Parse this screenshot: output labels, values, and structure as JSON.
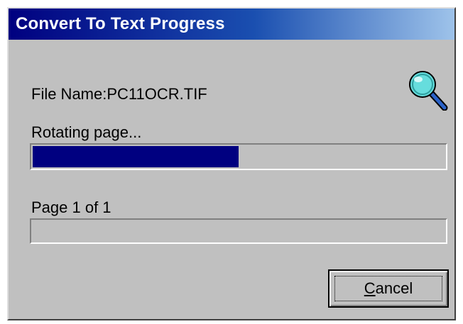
{
  "window": {
    "title": "Convert To Text Progress"
  },
  "file": {
    "label": "File Name:PC11OCR.TIF"
  },
  "status": {
    "text": "Rotating page..."
  },
  "progress": {
    "main_fraction": 0.5,
    "page_label": "Page 1 of 1",
    "pages_fraction": 0.0
  },
  "buttons": {
    "cancel_mnemonic": "C",
    "cancel_rest": "ancel"
  },
  "icons": {
    "search": "search-icon"
  },
  "colors": {
    "title_gradient_start": "#000080",
    "title_gradient_end": "#9ec3ea",
    "window_face": "#c0c0c0",
    "progress_fill": "#000080",
    "magnifier_lens": "#66dddd"
  }
}
